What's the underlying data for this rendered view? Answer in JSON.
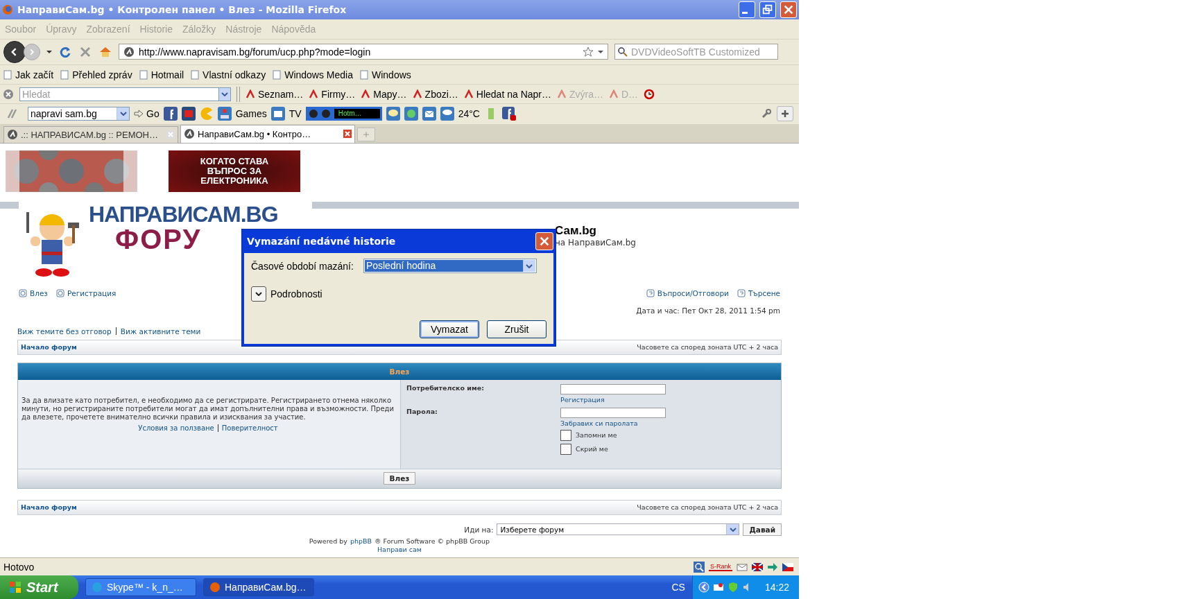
{
  "window": {
    "title": "НаправиСам.bg • Контролен панел • Влез - Mozilla Firefox"
  },
  "menu": [
    "Soubor",
    "Úpravy",
    "Zobrazení",
    "Historie",
    "Záložky",
    "Nástroje",
    "Nápověda"
  ],
  "address": {
    "value": "http://www.napravisam.bg/forum/ucp.php?mode=login"
  },
  "web_search": {
    "placeholder": "DVDVideoSoftTB Customized"
  },
  "bookmarks": [
    "Jak začít",
    "Přehled zpráv",
    "Hotmail",
    "Vlastní odkazy",
    "Windows Media",
    "Windows"
  ],
  "toolbar_search": {
    "placeholder": "Hledat"
  },
  "toolbar_links": [
    {
      "label": "Seznam…",
      "disabled": false
    },
    {
      "label": "Firmy…",
      "disabled": false
    },
    {
      "label": "Mapy…",
      "disabled": false
    },
    {
      "label": "Zbozi…",
      "disabled": false
    },
    {
      "label": "Hledat na Napr…",
      "disabled": false
    },
    {
      "label": "Zvýra…",
      "disabled": true
    },
    {
      "label": "D…",
      "disabled": true
    }
  ],
  "custom_toolbar": {
    "field": "napravi sam.bg",
    "go": "Go",
    "games": "Games",
    "tv": "TV",
    "player": "Hotm…",
    "weather": "24°C"
  },
  "tabs": [
    {
      "label": ".:: НАПРАВИСАМ.bg :: РЕМОН…",
      "selected": false
    },
    {
      "label": "НаправиСам.bg • Контро…",
      "selected": true
    }
  ],
  "ad_banner": [
    "КОГАТО СТАВА",
    "ВЪПРОС ЗА",
    "ЕЛЕКТРОНИКА"
  ],
  "logo": [
    "НАПРАВИСАМ.BG",
    "ФОРУ"
  ],
  "header": {
    "title": "Сам.bg",
    "subtitle": "на НаправиСам.bg"
  },
  "nav_left": [
    "Влез",
    "Регистрация"
  ],
  "nav_right": [
    "Въпроси/Отговори",
    "Търсене"
  ],
  "datetime": "Дата и час: Пет Окт 28, 2011 1:54 pm",
  "quick_links": [
    "Виж темите без отговор",
    "Виж активните теми"
  ],
  "breadcrumbs": [
    {
      "home": "Начало форум",
      "timezone": "Часовете са според зоната UTC + 2 часа"
    },
    {
      "home": "Начало форум",
      "timezone": "Часовете са според зоната UTC + 2 часа"
    }
  ],
  "login": {
    "title": "Влез",
    "intro": "За да влизате като потребител, е необходимо да се регистрирате. Регистрирането отнема няколко минути, но регистрираните потребители могат да имат допълнителни права и възможности. Преди да влезете, прочетете внимателно всички правила и изисквания за участие.",
    "links": [
      "Условия за ползване",
      "Поверителност"
    ],
    "username_label": "Потребителско име:",
    "register": "Регистрация",
    "password_label": "Парола:",
    "forgot": "Забравих си паролата",
    "options": [
      {
        "label": "Запомни ме",
        "checked": false
      },
      {
        "label": "Скрий ме",
        "checked": false
      }
    ],
    "submit": "Влез"
  },
  "jump": {
    "label": "Иди на:",
    "value": "Изберете форум",
    "button": "Давай"
  },
  "footer": {
    "powered_prefix": "Powered by",
    "powered_link": "phpBB",
    "powered_suffix": "® Forum Software © phpBB Group",
    "site_link": "Направи сам"
  },
  "status": {
    "text": "Hotovo",
    "rank": "S-Rank"
  },
  "taskbar": {
    "start": "Start",
    "tasks": [
      {
        "label": "Skype™ - k_n_…",
        "selected": false
      },
      {
        "label": "НаправиСам.bg…",
        "selected": true
      }
    ],
    "lang": "CS",
    "clock": "14:22"
  },
  "dialog": {
    "title": "Vymazání nedávné historie",
    "range_label": "Časové období mazání:",
    "range_value": "Poslední hodina",
    "details": "Podrobnosti",
    "details_expanded": false,
    "buttons": [
      "Vymazat",
      "Zrušit"
    ]
  }
}
